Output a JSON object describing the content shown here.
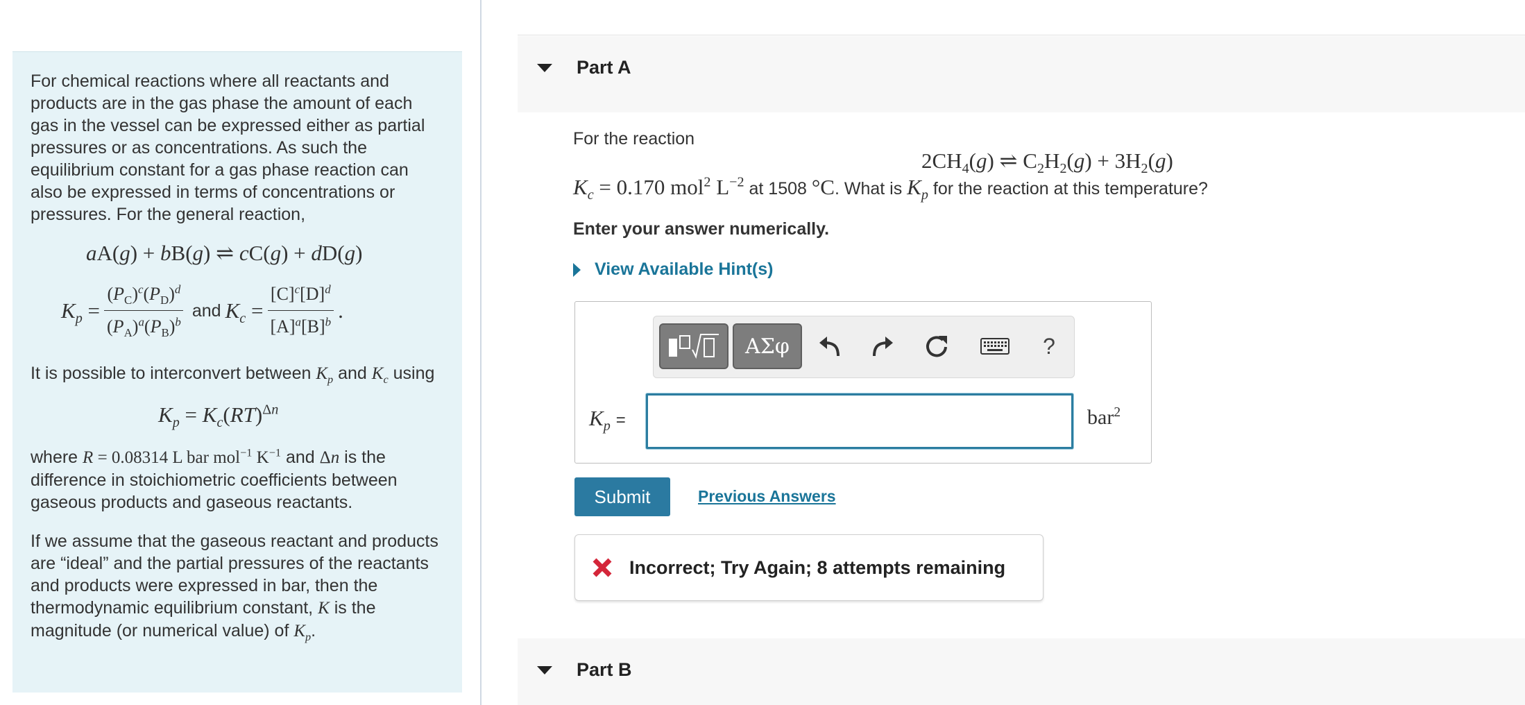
{
  "intro": {
    "p1": "For chemical reactions where all reactants and products are in the gas phase the amount of each gas in the vessel can be expressed either as partial pressures or as concentrations. As such the equilibrium constant for a gas phase reaction can also be expressed in terms of concentrations or pressures. For the general reaction,",
    "and": "and",
    "p2_start": "It is possible to interconvert between",
    "p2_and": "and",
    "p2_end": "using",
    "p3_start": "where",
    "p3_and": "and",
    "p3_end": "is the difference in stoichiometric coefficients between gaseous products and gaseous reactants.",
    "p4": "If we assume that the gaseous reactant and products are “ideal” and the partial pressures of the reactants and products were expressed in bar, then the thermodynamic equilibrium constant,",
    "p4_mid": "is the magnitude (or numerical value) of"
  },
  "part_a": {
    "title": "Part A",
    "question_intro": "For the reaction",
    "kc_value": "0.170",
    "at_text": "at 1508",
    "question_tail": ". What is",
    "question_end": "for the reaction at this temperature?",
    "instruction": "Enter your answer numerically.",
    "hint_link": "View Available Hint(s)",
    "answer_value": "",
    "unit": "bar",
    "unit_exp": "2",
    "submit_label": "Submit",
    "previous_answers": "Previous Answers",
    "feedback": "Incorrect; Try Again; 8 attempts remaining"
  },
  "toolbar": {
    "symbols_label": "ΑΣφ",
    "help_label": "?",
    "icons": [
      "templates-icon",
      "symbols-icon",
      "undo-icon",
      "redo-icon",
      "reset-icon",
      "keyboard-icon",
      "help-icon"
    ]
  },
  "part_b": {
    "title": "Part B"
  },
  "colors": {
    "panel_bg": "#e6f3f7",
    "link": "#1a7599",
    "submit_bg": "#2b7aa1",
    "input_border": "#2c7da0",
    "error_red": "#d4263a"
  }
}
